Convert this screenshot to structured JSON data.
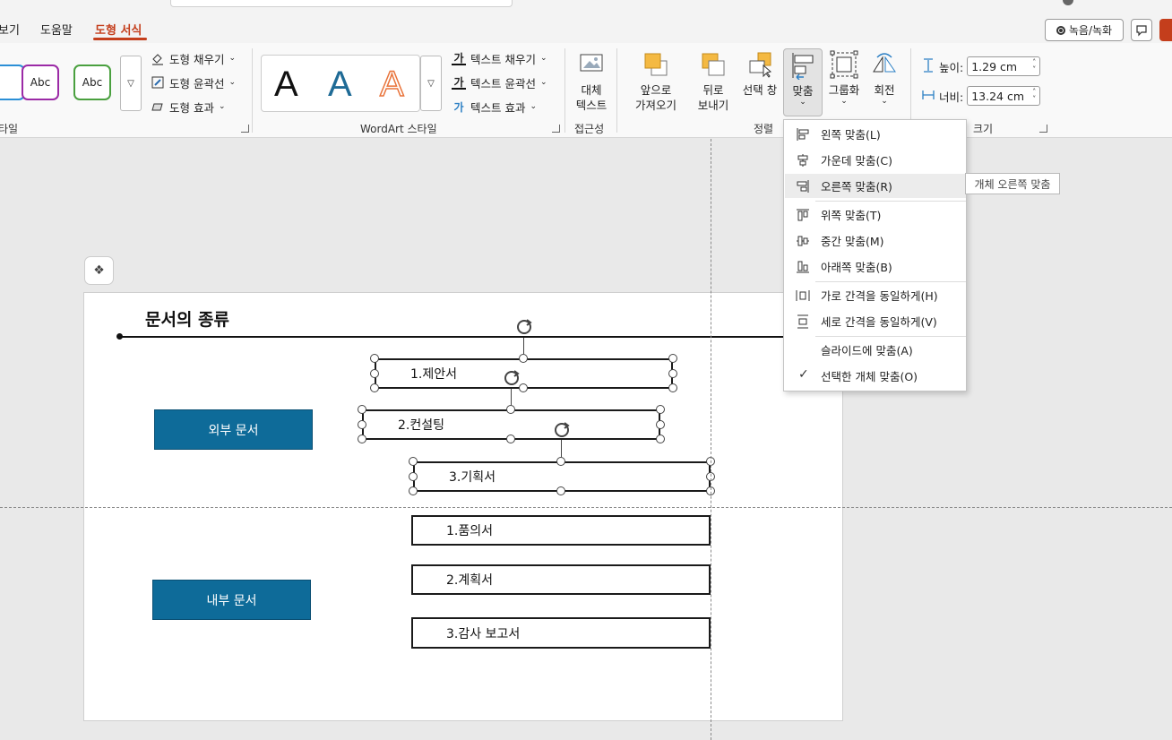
{
  "tabs": [
    {
      "label": "보기"
    },
    {
      "label": "도움말"
    },
    {
      "label": "도형 서식"
    }
  ],
  "right_buttons": {
    "record_label": "녹음/녹화"
  },
  "ribbon": {
    "shape_styles": {
      "group_label": "타일",
      "styles": [
        {
          "label": "Abc",
          "border_color": "#9b2aa6"
        },
        {
          "label": "Abc",
          "border_color": "#4aa03f"
        }
      ],
      "fill": "도형 채우기",
      "outline": "도형 윤곽선",
      "effects": "도형 효과"
    },
    "wordart": {
      "group_label": "WordArt 스타일",
      "letters": [
        "A",
        "A",
        "A"
      ],
      "text_fill": "텍스트 채우기",
      "text_outline": "텍스트 윤곽선",
      "text_effects": "텍스트 효과"
    },
    "accessibility": {
      "group_label": "접근성",
      "alt_text_line1": "대체",
      "alt_text_line2": "텍스트"
    },
    "arrange": {
      "group_label": "정렬",
      "bring_forward_1": "앞으로",
      "bring_forward_2": "가져오기",
      "send_backward_1": "뒤로",
      "send_backward_2": "보내기",
      "selection_pane": "선택 창",
      "align": "맞춤",
      "group": "그룹화",
      "rotate": "회전"
    },
    "size": {
      "group_label": "크기",
      "height_label": "높이:",
      "height_value": "1.29 cm",
      "width_label": "너비:",
      "width_value": "13.24 cm"
    }
  },
  "slide": {
    "title": "문서의 종류",
    "external_label": "외부 문서",
    "internal_label": "내부 문서",
    "external_docs": [
      "1.제안서",
      "2.컨설팅",
      "3.기획서"
    ],
    "internal_docs": [
      "1.품의서",
      "2.계획서",
      "3.감사 보고서"
    ]
  },
  "align_menu": {
    "items": [
      {
        "label": "왼쪽 맞춤(L)",
        "icon": "align-left-icon"
      },
      {
        "label": "가운데 맞춤(C)",
        "icon": "align-center-icon"
      },
      {
        "label": "오른쪽 맞춤(R)",
        "icon": "align-right-icon"
      },
      {
        "label": "위쪽 맞춤(T)",
        "icon": "align-top-icon"
      },
      {
        "label": "중간 맞춤(M)",
        "icon": "align-middle-icon"
      },
      {
        "label": "아래쪽 맞춤(B)",
        "icon": "align-bottom-icon"
      },
      {
        "label": "가로 간격을 동일하게(H)",
        "icon": "distribute-horizontal-icon"
      },
      {
        "label": "세로 간격을 동일하게(V)",
        "icon": "distribute-vertical-icon"
      },
      {
        "label": "슬라이드에 맞춤(A)",
        "icon": ""
      },
      {
        "label": "선택한 개체 맞춤(O)",
        "icon": "check-icon"
      }
    ],
    "tooltip": "개체 오른쪽 맞춤"
  },
  "colors": {
    "accent": "#c43e1c",
    "blue_box": "#0e6b99"
  }
}
